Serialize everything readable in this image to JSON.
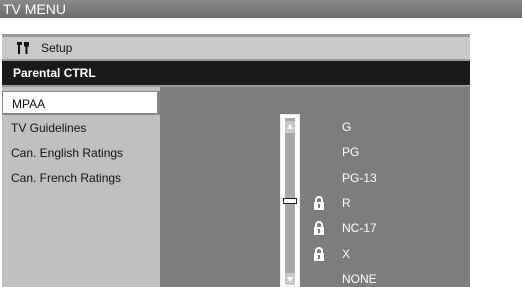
{
  "title": "TV MENU",
  "setup": {
    "label": "Setup",
    "icon": "wrench-screwdriver-icon"
  },
  "section": "Parental CTRL",
  "menu": [
    {
      "label": "MPAA",
      "selected": true
    },
    {
      "label": "TV Guidelines",
      "selected": false
    },
    {
      "label": "Can. English Ratings",
      "selected": false
    },
    {
      "label": "Can. French Ratings",
      "selected": false
    }
  ],
  "ratings": [
    {
      "label": "G",
      "locked": false
    },
    {
      "label": "PG",
      "locked": false
    },
    {
      "label": "PG-13",
      "locked": false
    },
    {
      "label": "R",
      "locked": true
    },
    {
      "label": "NC-17",
      "locked": true
    },
    {
      "label": "X",
      "locked": true
    },
    {
      "label": "NONE",
      "locked": false
    }
  ],
  "colors": {
    "title_bar": "#777777",
    "section_bar": "#1a1a1a",
    "panel": "#7d7d7d",
    "menu_bg": "#c0c0c0"
  }
}
